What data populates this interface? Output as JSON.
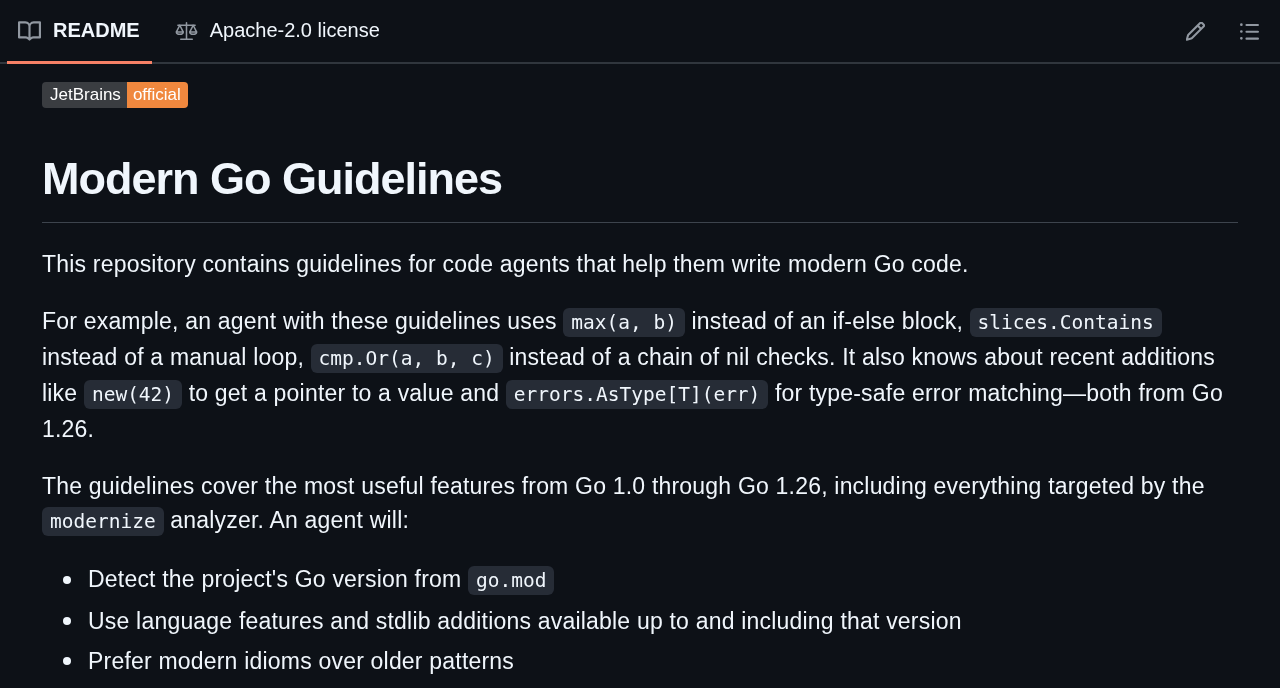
{
  "tabs": [
    {
      "kind": "readme",
      "label": "README",
      "selected": true
    },
    {
      "kind": "license",
      "label": "Apache-2.0 license",
      "selected": false
    }
  ],
  "readme": {
    "badge": {
      "label": "JetBrains",
      "message": "official"
    },
    "heading": "Modern Go Guidelines",
    "blocks": [
      {
        "kind": "paragraph",
        "segments": [
          {
            "kind": "text",
            "text": "This repository contains guidelines for code agents that help them write modern Go code."
          }
        ]
      },
      {
        "kind": "paragraph",
        "segments": [
          {
            "kind": "text",
            "text": "For example, an agent with these guidelines uses "
          },
          {
            "kind": "code",
            "text": "max(a, b)"
          },
          {
            "kind": "text",
            "text": " instead of an if-else block, "
          },
          {
            "kind": "code",
            "text": "slices.Contains"
          },
          {
            "kind": "text",
            "text": " instead of a manual loop, "
          },
          {
            "kind": "code",
            "text": "cmp.Or(a, b, c)"
          },
          {
            "kind": "text",
            "text": " instead of a chain of nil checks. It also knows about recent additions like "
          },
          {
            "kind": "code",
            "text": "new(42)"
          },
          {
            "kind": "text",
            "text": " to get a pointer to a value and "
          },
          {
            "kind": "code",
            "text": "errors.AsType[T](err)"
          },
          {
            "kind": "text",
            "text": " for type-safe error matching—both from Go 1.26."
          }
        ]
      },
      {
        "kind": "paragraph",
        "segments": [
          {
            "kind": "text",
            "text": "The guidelines cover the most useful features from Go 1.0 through Go 1.26, including everything targeted by the "
          },
          {
            "kind": "code",
            "text": "modernize"
          },
          {
            "kind": "text",
            "text": " analyzer. An agent will:"
          }
        ]
      },
      {
        "kind": "list",
        "items": [
          {
            "segments": [
              {
                "kind": "text",
                "text": "Detect the project's Go version from "
              },
              {
                "kind": "code",
                "text": "go.mod"
              }
            ]
          },
          {
            "segments": [
              {
                "kind": "text",
                "text": "Use language features and stdlib additions available up to and including that version"
              }
            ]
          },
          {
            "segments": [
              {
                "kind": "text",
                "text": "Prefer modern idioms over older patterns"
              }
            ]
          }
        ]
      }
    ]
  }
}
